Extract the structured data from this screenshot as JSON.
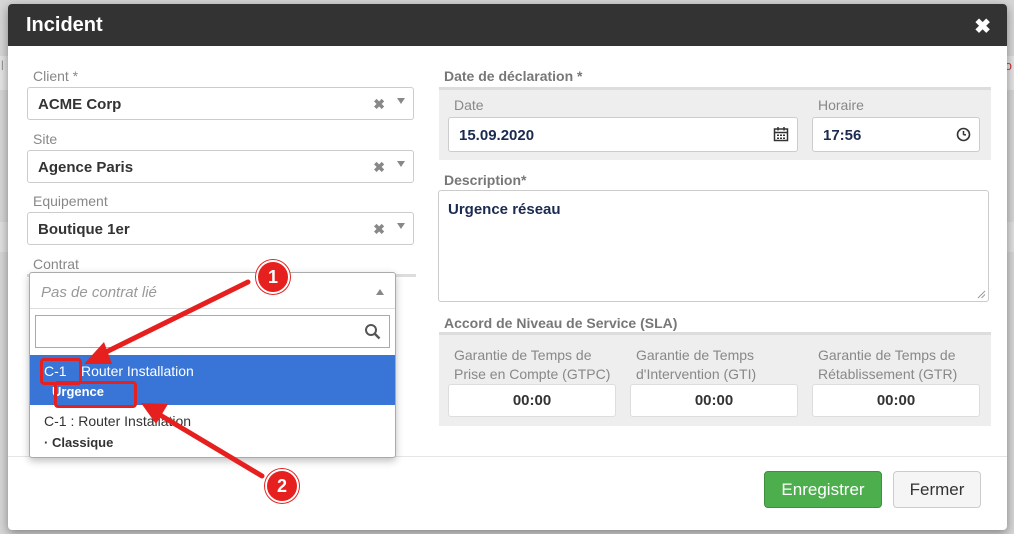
{
  "modal": {
    "title": "Incident",
    "close_glyph": "✖"
  },
  "left": {
    "client": {
      "label": "Client *",
      "value": "ACME Corp"
    },
    "site": {
      "label": "Site",
      "value": "Agence Paris"
    },
    "equipement": {
      "label": "Equipement",
      "value": "Boutique 1er"
    },
    "contrat": {
      "label": "Contrat",
      "placeholder": "Pas de contrat lié"
    },
    "clear_glyph": "✖"
  },
  "dropdown": {
    "options": [
      {
        "code": "C-1",
        "name": "Router Installation",
        "sub": "Urgence"
      },
      {
        "main": "C-1 : Router Installation",
        "sub": "· Classique"
      }
    ]
  },
  "declaration": {
    "title": "Date de déclaration *",
    "date_label": "Date",
    "date_value": "15.09.2020",
    "time_label": "Horaire",
    "time_value": "17:56"
  },
  "description": {
    "label": "Description*",
    "value": "Urgence réseau"
  },
  "sla": {
    "title": "Accord de Niveau de Service (SLA)",
    "items": [
      {
        "label": "Garantie de Temps de Prise en Compte (GTPC)",
        "value": "00:00"
      },
      {
        "label": "Garantie de Temps d'Intervention (GTI)",
        "value": "00:00"
      },
      {
        "label": "Garantie de Temps de Rétablissement (GTR)",
        "value": "00:00"
      }
    ]
  },
  "footer": {
    "save_label": "Enregistrer",
    "close_label": "Fermer"
  },
  "annotations": {
    "badge1": "1",
    "badge2": "2"
  },
  "background": {
    "edge_letter": "o",
    "edge_letter_left": "l"
  },
  "colors": {
    "header": "#333333",
    "selected": "#3875d7",
    "save": "#4cae4c",
    "marker": "#e5201f"
  },
  "icons": [
    "close-icon",
    "clear-icon",
    "chevron-down-icon",
    "chevron-up-icon",
    "search-icon",
    "calendar-icon",
    "clock-icon"
  ]
}
